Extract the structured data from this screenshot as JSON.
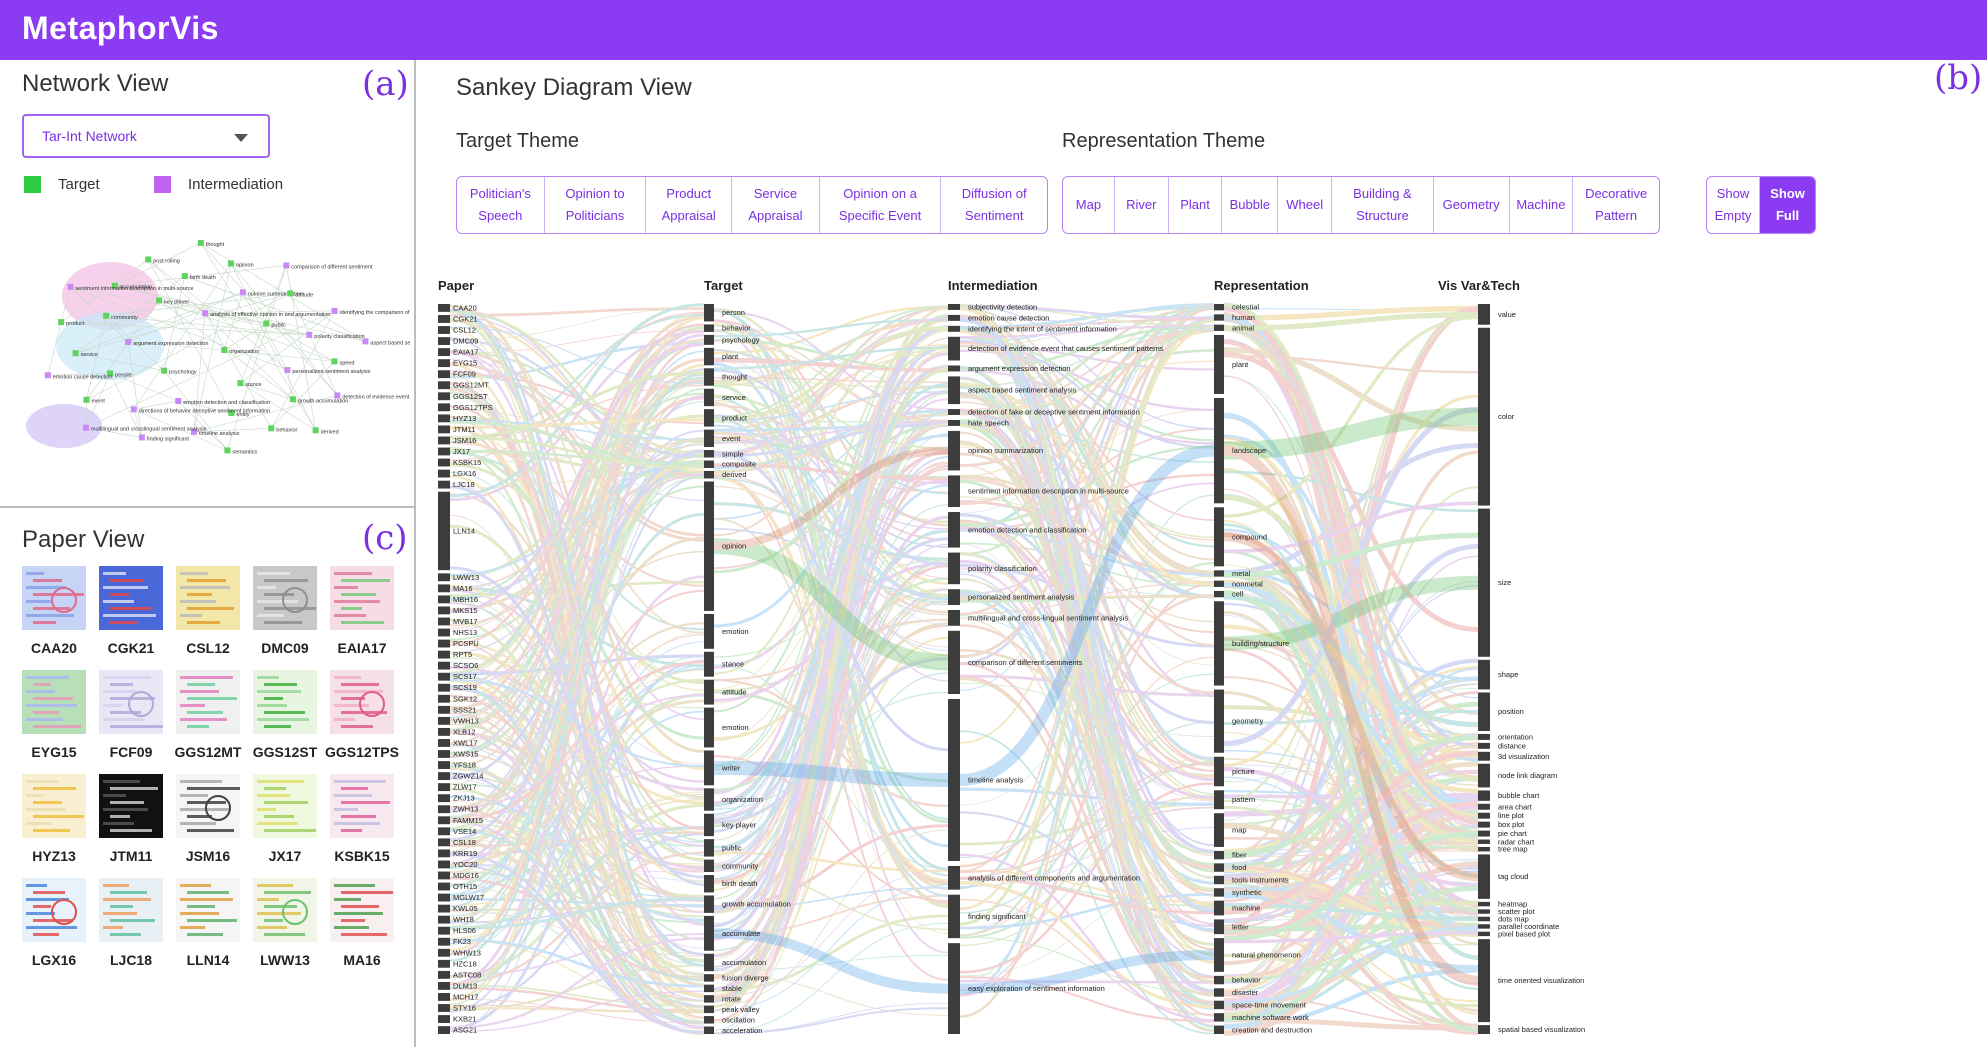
{
  "app": {
    "title": "MetaphorVis"
  },
  "network_view": {
    "title": "Network View",
    "panel_letter": "(a)",
    "select_value": "Tar-Int Network",
    "legend": [
      {
        "label": "Target",
        "color": "#2ecc40"
      },
      {
        "label": "Intermediation",
        "color": "#c063f0"
      }
    ],
    "target_color": "#5fd35f",
    "intermediation_color": "#c98af5",
    "nodes": [
      "organization",
      "psychology",
      "analysis of effective opinion in and argumentation",
      "stance",
      "argument expression detection",
      "public",
      "emotion detection and classification",
      "key player",
      "personalized sentiment analysis",
      "people",
      "opinion summarization",
      "entity",
      "community",
      "polarity classification",
      "directions of behavior deceptive sentiment information",
      "birth death",
      "growth accumulation",
      "service",
      "attitude",
      "timeline analysis",
      "accumulation",
      "speed",
      "event",
      "opinion",
      "behavior",
      "product",
      "identifying the comparison of different sentiment",
      "finding significant",
      "post rolling",
      "detection of evidence event that causes sentiment patterns",
      "emotion cause detection",
      "comparison of different sentiment",
      "semantics",
      "sentiment information description in multi-source",
      "aspect based sentiment analysis",
      "multilingual and crosslingual sentiment analysis",
      "thought",
      "derived"
    ]
  },
  "paper_view": {
    "title": "Paper View",
    "panel_letter": "(c)",
    "papers": [
      "CAA20",
      "CGK21",
      "CSL12",
      "DMC09",
      "EAIA17",
      "EYG15",
      "FCF09",
      "GGS12MT",
      "GGS12ST",
      "GGS12TPS",
      "HYZ13",
      "JTM11",
      "JSM16",
      "JX17",
      "KSBK15",
      "LGX16",
      "LJC18",
      "LLN14",
      "LWW13",
      "MA16"
    ]
  },
  "sankey_view": {
    "title": "Sankey Diagram View",
    "panel_letter": "(b)",
    "target_theme": {
      "heading": "Target Theme",
      "buttons": [
        "Politician's\nSpeech",
        "Opinion to\nPoliticians",
        "Product\nAppraisal",
        "Service\nAppraisal",
        "Opinion on a\nSpecific Event",
        "Diffusion of\nSentiment"
      ]
    },
    "representation_theme": {
      "heading": "Representation Theme",
      "buttons": [
        "Map",
        "River",
        "Plant",
        "Bubble",
        "Wheel",
        "Building &\nStructure",
        "Geometry",
        "Machine",
        "Decorative\nPattern"
      ]
    },
    "show_toggle": {
      "empty": "Show\nEmpty",
      "full": "Show\nFull",
      "active": "full"
    }
  },
  "sankey_data": {
    "columns": [
      "Paper",
      "Target",
      "Intermediation",
      "Representation",
      "Vis Var&Tech"
    ],
    "papers": [
      "CAA20",
      "CGK21",
      "CSL12",
      "DMC09",
      "EAIA17",
      "EYG15",
      "FCF09",
      "GGS12MT",
      "GGS12ST",
      "GGS12TPS",
      "HYZ13",
      "JTM11",
      "JSM16",
      "JX17",
      "KSBK15",
      "LGX16",
      "LJC18",
      "LLN14",
      "LWW13",
      "MA16",
      "MBH16",
      "MKS15",
      "MVB17",
      "NHS13",
      "PCSPU",
      "RPT5",
      "SCSO6",
      "SCS17",
      "SCS19",
      "SGK12",
      "SSS21",
      "VWH13",
      "XLB12",
      "XWL17",
      "XWS15",
      "YFS18",
      "ZGWZ14",
      "ZLW17",
      "ZKJ13",
      "ZWH13",
      "FAMM15",
      "VSE14",
      "CSL18",
      "KRR19",
      "YOC20",
      "MDG16",
      "OTH15",
      "MGLW17",
      "KWL05",
      "WH18",
      "HLS06",
      "FK23",
      "WHW13",
      "HZC18",
      "ASTC08",
      "DLM13",
      "MCH17",
      "STY16",
      "KXB21",
      "ASG21"
    ],
    "targets": [
      {
        "name": "person",
        "w": 7
      },
      {
        "name": "behavior",
        "w": 3
      },
      {
        "name": "psychology",
        "w": 4
      },
      {
        "name": "plant",
        "w": 7
      },
      {
        "name": "thought",
        "w": 7
      },
      {
        "name": "service",
        "w": 7
      },
      {
        "name": "product",
        "w": 7
      },
      {
        "name": "event",
        "w": 7
      },
      {
        "name": "simple",
        "w": 3
      },
      {
        "name": "composite",
        "w": 3
      },
      {
        "name": "derived",
        "w": 3
      },
      {
        "name": "opinion",
        "w": 52
      },
      {
        "name": "emotion",
        "w": 14
      },
      {
        "name": "stance",
        "w": 10
      },
      {
        "name": "attitude",
        "w": 10
      },
      {
        "name": "emotion",
        "w": 16
      },
      {
        "name": "writer",
        "w": 14
      },
      {
        "name": "organization",
        "w": 9
      },
      {
        "name": "key player",
        "w": 9
      },
      {
        "name": "public",
        "w": 7
      },
      {
        "name": "community",
        "w": 5
      },
      {
        "name": "birth death",
        "w": 7
      },
      {
        "name": "growth accumulation",
        "w": 7
      },
      {
        "name": "accumulate",
        "w": 14
      },
      {
        "name": "accumulation",
        "w": 7
      },
      {
        "name": "fusion diverge",
        "w": 3
      },
      {
        "name": "stable",
        "w": 3
      },
      {
        "name": "rotate",
        "w": 3
      },
      {
        "name": "peak valley",
        "w": 3
      },
      {
        "name": "oscillation",
        "w": 3
      },
      {
        "name": "acceleration",
        "w": 3
      }
    ],
    "intermediations": [
      {
        "name": "subjectivity detection",
        "w": 3
      },
      {
        "name": "emotion cause detection",
        "w": 3
      },
      {
        "name": "identifying the intent of sentiment information",
        "w": 3
      },
      {
        "name": "detection of evidence event that causes sentiment patterns",
        "w": 12
      },
      {
        "name": "argument expression detection",
        "w": 3
      },
      {
        "name": "aspect based sentiment analysis",
        "w": 14
      },
      {
        "name": "detection of fake or deceptive sentiment information",
        "w": 3
      },
      {
        "name": "hate speech",
        "w": 3
      },
      {
        "name": "opinion summarization",
        "w": 20
      },
      {
        "name": "sentiment information description in multi-source",
        "w": 16
      },
      {
        "name": "emotion detection and classification",
        "w": 18
      },
      {
        "name": "polarity classification",
        "w": 16
      },
      {
        "name": "personalized sentiment analysis",
        "w": 8
      },
      {
        "name": "multilingual and cross-lingual sentiment analysis",
        "w": 8
      },
      {
        "name": "comparison of different sentiments",
        "w": 32
      },
      {
        "name": "timeline analysis",
        "w": 82
      },
      {
        "name": "analysis of different components and argumentation",
        "w": 12
      },
      {
        "name": "finding significant",
        "w": 22
      },
      {
        "name": "easy exploration of sentiment information",
        "w": 46
      }
    ],
    "representations": [
      {
        "name": "celestial",
        "w": 3
      },
      {
        "name": "human",
        "w": 3
      },
      {
        "name": "animal",
        "w": 3
      },
      {
        "name": "plant",
        "w": 28
      },
      {
        "name": "landscape",
        "w": 50
      },
      {
        "name": "compound",
        "w": 28
      },
      {
        "name": "metal",
        "w": 3
      },
      {
        "name": "nonmetal",
        "w": 3
      },
      {
        "name": "cell",
        "w": 3
      },
      {
        "name": "building/structure",
        "w": 40
      },
      {
        "name": "geometry",
        "w": 30
      },
      {
        "name": "picture",
        "w": 14
      },
      {
        "name": "pattern",
        "w": 9
      },
      {
        "name": "map",
        "w": 16
      },
      {
        "name": "fiber",
        "w": 4
      },
      {
        "name": "food",
        "w": 4
      },
      {
        "name": "tools instruments",
        "w": 4
      },
      {
        "name": "synthetic",
        "w": 4
      },
      {
        "name": "machine",
        "w": 7
      },
      {
        "name": "letter",
        "w": 7
      },
      {
        "name": "natural phenomenon",
        "w": 16
      },
      {
        "name": "behavior",
        "w": 4
      },
      {
        "name": "disaster",
        "w": 4
      },
      {
        "name": "space-time movement",
        "w": 4
      },
      {
        "name": "machine software work",
        "w": 4
      },
      {
        "name": "creation and destruction",
        "w": 4
      }
    ],
    "vis_vartech": [
      {
        "name": "value",
        "w": 14
      },
      {
        "name": "color",
        "w": 120
      },
      {
        "name": "size",
        "w": 100
      },
      {
        "name": "shape",
        "w": 20
      },
      {
        "name": "position",
        "w": 26
      },
      {
        "name": "orientation",
        "w": 4
      },
      {
        "name": "distance",
        "w": 4
      },
      {
        "name": "3d visualization",
        "w": 6
      },
      {
        "name": "node link diagram",
        "w": 16
      },
      {
        "name": "bubble chart",
        "w": 7
      },
      {
        "name": "area chart",
        "w": 4
      },
      {
        "name": "line plot",
        "w": 4
      },
      {
        "name": "box plot",
        "w": 4
      },
      {
        "name": "pie chart",
        "w": 4
      },
      {
        "name": "radar chart",
        "w": 3
      },
      {
        "name": "tree map",
        "w": 3
      },
      {
        "name": "tag cloud",
        "w": 30
      },
      {
        "name": "heatmap",
        "w": 3
      },
      {
        "name": "scatter plot",
        "w": 3
      },
      {
        "name": "dots map",
        "w": 3
      },
      {
        "name": "parallel coordinate",
        "w": 3
      },
      {
        "name": "pixel based plot",
        "w": 3
      },
      {
        "name": "time oriented visualization",
        "w": 56
      },
      {
        "name": "spatial based visualization",
        "w": 6
      }
    ],
    "link_colors": [
      "#6cc36c",
      "#58a7e8",
      "#d98a6a",
      "#e0b840",
      "#c07ad0",
      "#4fb3b0",
      "#a0c050",
      "#e07070",
      "#7f8ce0",
      "#c9a060"
    ]
  }
}
